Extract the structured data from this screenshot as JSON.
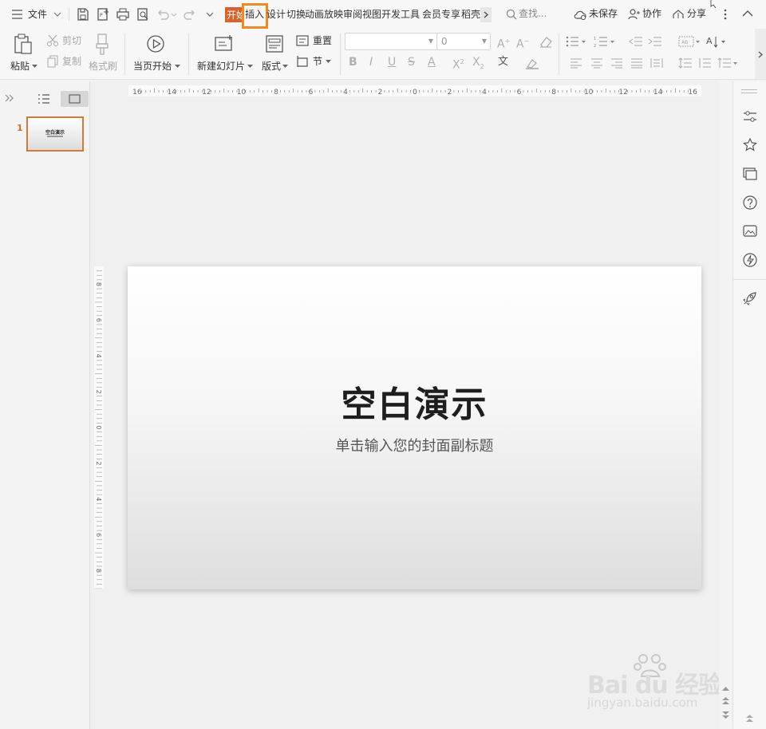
{
  "titlebar": {
    "file_menu": "文件",
    "tabs": [
      {
        "label": "开始",
        "active": true
      },
      {
        "label": "插入",
        "highlighted": true
      },
      {
        "label": "设计"
      },
      {
        "label": "切换"
      },
      {
        "label": "动画"
      },
      {
        "label": "放映"
      },
      {
        "label": "审阅"
      },
      {
        "label": "视图"
      },
      {
        "label": "开发工具"
      },
      {
        "label": "会员专享"
      },
      {
        "label": "稻壳"
      }
    ],
    "search": "查找...",
    "unsaved": "未保存",
    "collab": "协作",
    "share": "分享"
  },
  "ribbon": {
    "paste": "粘贴",
    "cut": "剪切",
    "copy": "复制",
    "format_painter": "格式刷",
    "play_from_current": "当页开始",
    "new_slide": "新建幻灯片",
    "layout": "版式",
    "section": "节",
    "reset": "重置",
    "font_name": "",
    "font_size": "0"
  },
  "ruler": {
    "h_ticks": [
      "16",
      "14",
      "12",
      "10",
      "8",
      "6",
      "4",
      "2",
      "0",
      "2",
      "4",
      "6",
      "8",
      "10",
      "12",
      "14",
      "16"
    ],
    "v_ticks": [
      "8",
      "6",
      "4",
      "2",
      "0",
      "2",
      "4",
      "6",
      "8"
    ]
  },
  "thumbnails": [
    {
      "number": "1",
      "title": "空白演示"
    }
  ],
  "slide": {
    "title": "空白演示",
    "subtitle": "单击输入您的封面副标题"
  },
  "watermark": {
    "brand": "Bai du 经验",
    "url": "jingyan.baidu.com"
  },
  "colors": {
    "accent": "#d9622b",
    "highlight": "#f08a1c",
    "thumb_border": "#d27a3a"
  },
  "icons": {
    "menu": "hamburger-icon",
    "save": "save-icon",
    "print": "print-icon",
    "search": "search-icon"
  }
}
